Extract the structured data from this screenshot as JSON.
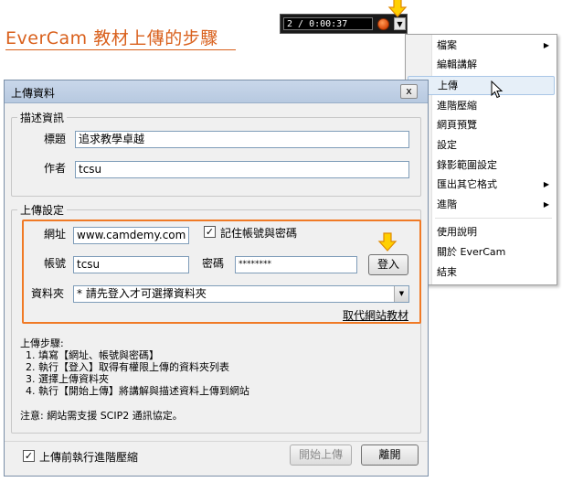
{
  "doc_title": "EverCam 教材上傳的步驟",
  "recorder": {
    "time": "2 / 0:00:37"
  },
  "context_menu": {
    "items": [
      {
        "label": "檔案",
        "submenu": true
      },
      {
        "label": "編輯講解",
        "submenu": false
      },
      {
        "label": "上傳",
        "submenu": false,
        "highlighted": true
      },
      {
        "label": "進階壓縮",
        "submenu": false
      },
      {
        "label": "網頁預覽",
        "submenu": false
      },
      {
        "label": "設定",
        "submenu": false
      },
      {
        "label": "錄影範圍設定",
        "submenu": false
      },
      {
        "label": "匯出其它格式",
        "submenu": true
      },
      {
        "label": "進階",
        "submenu": true
      },
      {
        "label": "使用說明",
        "submenu": false
      },
      {
        "label": "關於 EverCam",
        "submenu": false
      },
      {
        "label": "結束",
        "submenu": false
      }
    ]
  },
  "dialog": {
    "title": "上傳資料",
    "close_glyph": "x",
    "desc_group": {
      "label": "描述資訊",
      "title_label": "標題",
      "title_value": "追求教學卓越",
      "author_label": "作者",
      "author_value": "tcsu"
    },
    "upload_group": {
      "label": "上傳設定",
      "url_label": "網址",
      "url_value": "www.camdemy.com",
      "remember_label": "記住帳號與密碼",
      "remember_checked": "✓",
      "account_label": "帳號",
      "account_value": "tcsu",
      "password_label": "密碼",
      "password_value": "********",
      "login_button": "登入",
      "folder_label": "資料夾",
      "folder_value": "* 請先登入才可選擇資料夾",
      "fetch_link": "取代網站教材"
    },
    "steps": {
      "heading": "上傳步驟:",
      "items": [
        "1. 填寫【網址、帳號與密碼】",
        "2. 執行【登入】取得有權限上傳的資料夾列表",
        "3. 選擇上傳資料夾",
        "4. 執行【開始上傳】將講解與描述資料上傳到網站"
      ],
      "note": "注意: 網站需支援 SCIP2 通訊協定。"
    },
    "footer": {
      "compress_label": "上傳前執行進階壓縮",
      "compress_checked": "✓",
      "start_button": "開始上傳",
      "close_button": "離開"
    }
  },
  "colors": {
    "accent": "#d9601c",
    "highlight_border": "#f07a26",
    "arrow_fill": "#ffd000"
  }
}
